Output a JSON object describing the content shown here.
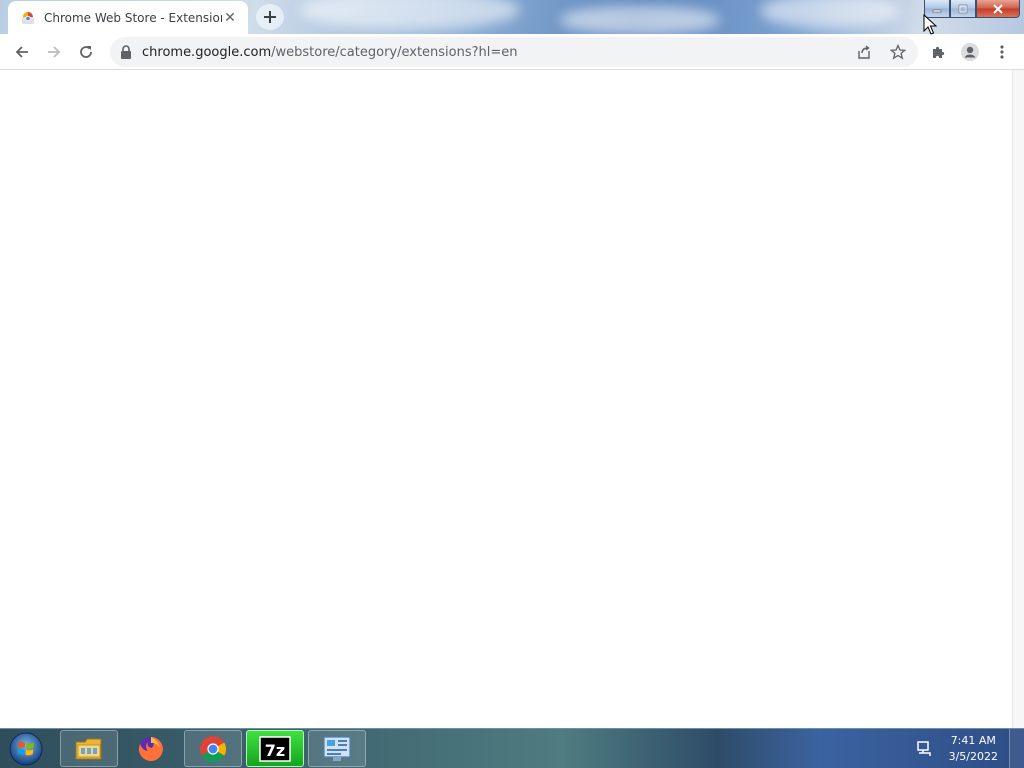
{
  "browser": {
    "tab": {
      "title": "Chrome Web Store - Extensions",
      "favicon": "chrome-web-store-icon"
    },
    "new_tab_icon": "plus-icon",
    "window_controls": [
      "minimize-icon",
      "maximize-icon",
      "close-icon"
    ],
    "toolbar": {
      "back_icon": "arrow-left-icon",
      "forward_icon": "arrow-right-icon",
      "reload_icon": "reload-icon",
      "url_host": "chrome.google.com",
      "url_path": "/webstore/category/extensions?hl=en",
      "share_icon": "share-icon",
      "bookmark_icon": "star-icon",
      "extensions_icon": "puzzle-icon",
      "profile_icon": "account-icon",
      "menu_icon": "kebab-menu-icon"
    }
  },
  "taskbar": {
    "apps": [
      {
        "name": "file-explorer",
        "icon": "folder-icon"
      },
      {
        "name": "firefox",
        "icon": "firefox-icon"
      },
      {
        "name": "chrome",
        "icon": "chrome-icon"
      },
      {
        "name": "7-zip",
        "icon": "7zip-icon",
        "label": "7z"
      },
      {
        "name": "control-panel",
        "icon": "control-panel-icon"
      }
    ],
    "clock": {
      "time": "7:41 AM",
      "date": "3/5/2022"
    }
  },
  "colors": {
    "tab_bg": "#ffffff",
    "omnibox_bg": "#f1f3f4",
    "close_red": "#c23c24",
    "active_task_green": "#16a51e"
  }
}
